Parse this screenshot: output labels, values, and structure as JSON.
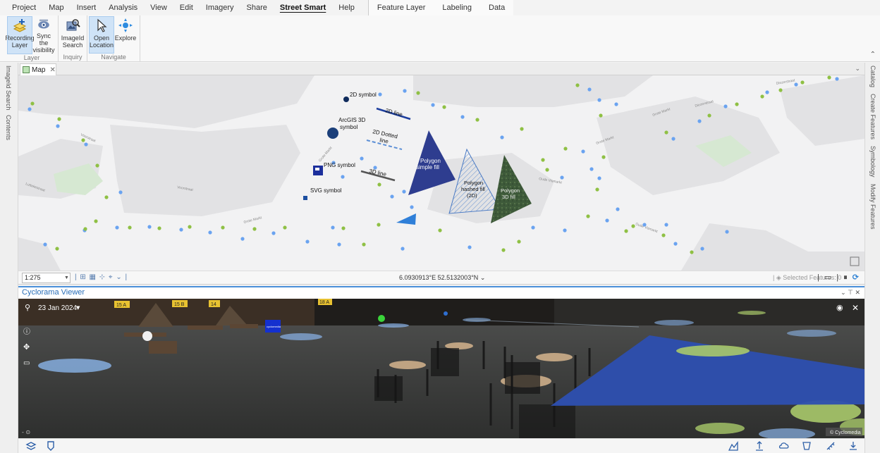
{
  "menu": {
    "items": [
      "Project",
      "Map",
      "Insert",
      "Analysis",
      "View",
      "Edit",
      "Imagery",
      "Share",
      "Street Smart",
      "Help"
    ],
    "active": "Street Smart",
    "contextual": [
      "Feature Layer",
      "Labeling",
      "Data"
    ]
  },
  "ribbon": {
    "groups": [
      {
        "label": "Layer",
        "buttons": [
          {
            "label": "Recording Layer",
            "icon": "recording-layer-icon",
            "selected": true
          },
          {
            "label": "Sync the visibility",
            "icon": "sync-visibility-icon",
            "selected": false
          }
        ]
      },
      {
        "label": "Inquiry",
        "buttons": [
          {
            "label": "ImageId Search",
            "icon": "imageid-search-icon",
            "selected": false
          }
        ]
      },
      {
        "label": "Navigate",
        "buttons": [
          {
            "label": "Open Location",
            "icon": "open-location-icon",
            "selected": true
          },
          {
            "label": "Explore",
            "icon": "explore-icon",
            "selected": false
          }
        ]
      }
    ]
  },
  "left_panels": [
    "ImageId Search",
    "Contents"
  ],
  "right_panels": [
    "Catalog",
    "Create Features",
    "Symbology",
    "Modify Features"
  ],
  "map": {
    "tab_label": "Map",
    "labels": {
      "symbol_2d": "2D symbol",
      "line_2d": "2D line",
      "arcgis_3d": "ArcGIS 3D symbol",
      "dotted_2d": "2D Dotted line",
      "png": "PNG symbol",
      "line_3d": "3D line",
      "svg": "SVG symbol",
      "poly_simple": "Polygon simple fill",
      "poly_hashed": "Polygon hashed fill (2D)",
      "poly_3d": "Polygon 3D fill"
    },
    "streets": [
      "Voorstraat",
      "Voorstraat",
      "Grote Markt",
      "Grote Markt",
      "Grote Markt",
      "Grote Markt",
      "Diezerstraat",
      "Diezerstraat",
      "Oude Vismarkt",
      "Oude Vismarkt",
      "Luttekestraat"
    ]
  },
  "status": {
    "scale": "1:275",
    "coordinates": "6.0930913°E 52.5132003°N",
    "selected_features": "Selected Features: 0"
  },
  "cyclorama": {
    "title": "Cyclorama Viewer",
    "date": "23 Jan 2024",
    "copyright": "© Cyclomedia",
    "signs": [
      "15 A",
      "15 B",
      "14",
      "18 A"
    ]
  },
  "colors": {
    "accent": "#4a90d9",
    "point_blue": "#6aa3f0",
    "point_green": "#8fc044",
    "poly_navy": "#2e3d8f",
    "poly_dark_green": "#3e5a3a"
  }
}
